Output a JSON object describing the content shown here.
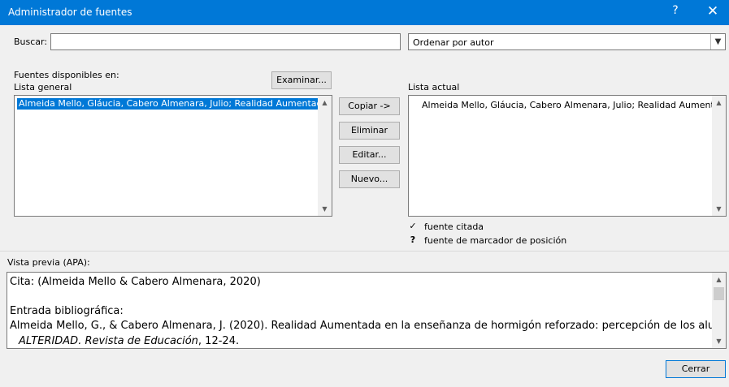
{
  "window": {
    "title": "Administrador de fuentes",
    "help_glyph": "?",
    "close_glyph": "✕"
  },
  "search": {
    "label": "Buscar:",
    "value": "",
    "placeholder": ""
  },
  "sort": {
    "selected": "Ordenar por autor"
  },
  "available": {
    "header": "Fuentes disponibles en:",
    "list_label": "Lista general",
    "browse_button": "Examinar...",
    "items": [
      "Almeida Mello, Gláucia, Cabero Almenara, Julio; Realidad Aumentada en"
    ]
  },
  "actions": {
    "copy": "Copiar ->",
    "delete": "Eliminar",
    "edit": "Editar...",
    "new": "Nuevo..."
  },
  "current": {
    "list_label": "Lista actual",
    "items": [
      "Almeida Mello, Gláucia, Cabero Almenara, Julio; Realidad Aumentada"
    ]
  },
  "legend": {
    "cited_mark": "✓",
    "cited_label": "fuente citada",
    "placeholder_mark": "?",
    "placeholder_label": "fuente de marcador de posición"
  },
  "preview": {
    "label": "Vista previa (APA):",
    "citation": "Cita:  (Almeida Mello & Cabero Almenara, 2020)",
    "bib_header": "Entrada bibliográfica:",
    "bib_line1": "Almeida Mello, G., & Cabero Almenara, J. (2020). Realidad Aumentada en la enseñanza de hormigón reforzado: percepción de los alumnos.",
    "bib_journal": "ALTERIDAD. Revista de Educación",
    "bib_pages": ", 12-24."
  },
  "footer": {
    "close_button": "Cerrar"
  }
}
